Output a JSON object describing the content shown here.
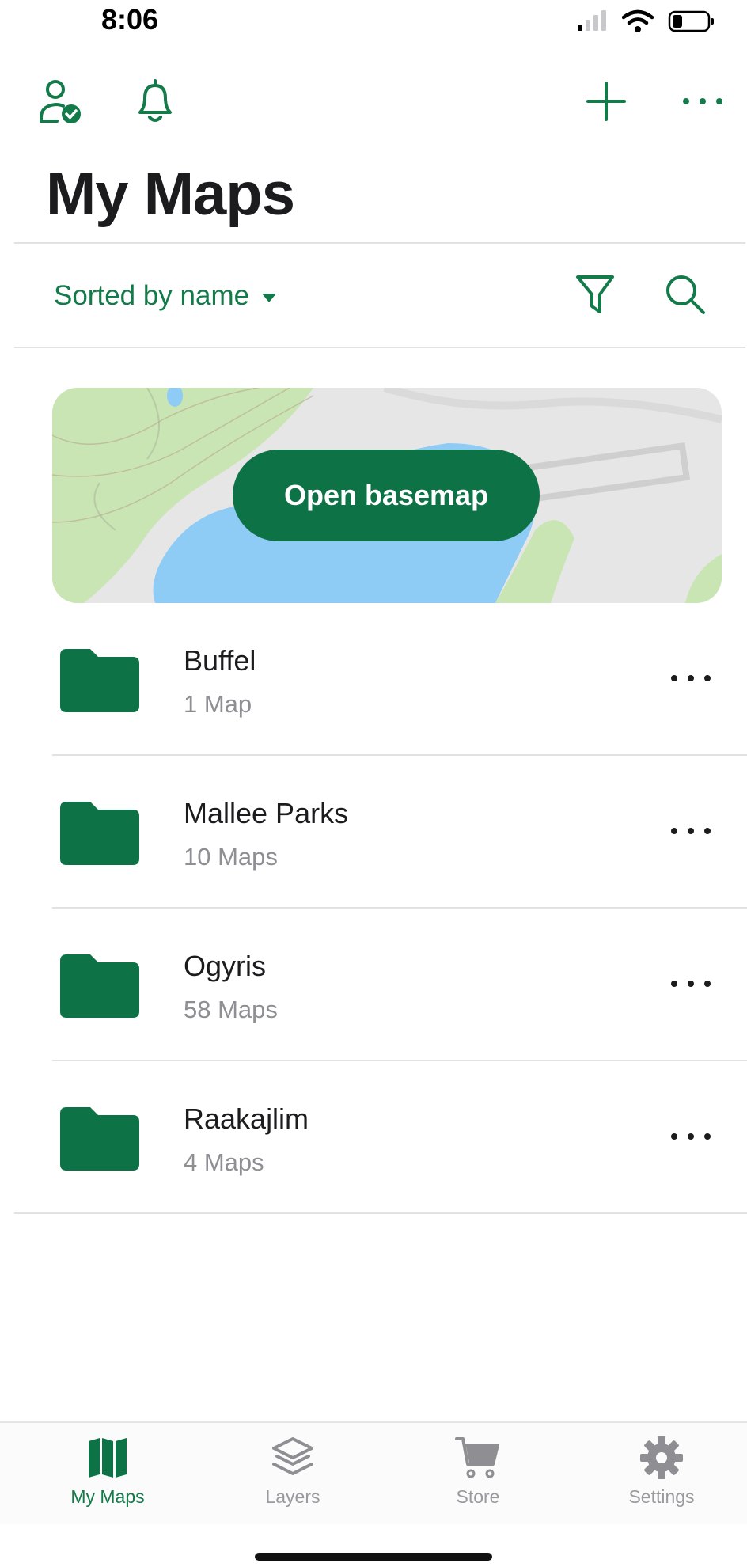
{
  "status_bar": {
    "time": "8:06",
    "icons": [
      "signal-icon",
      "wifi-icon",
      "battery-icon"
    ]
  },
  "header": {
    "account_icon": "account-verified-icon",
    "notifications_icon": "bell-icon",
    "add_icon": "plus-icon",
    "more_icon": "more-horizontal-icon",
    "title": "My Maps"
  },
  "toolbar": {
    "sort_label": "Sorted by name",
    "filter_icon": "filter-icon",
    "search_icon": "search-icon"
  },
  "basemap": {
    "button_label": "Open basemap"
  },
  "folders": [
    {
      "name": "Buffel",
      "count": "1 Map"
    },
    {
      "name": "Mallee Parks",
      "count": "10 Maps"
    },
    {
      "name": "Ogyris",
      "count": "58 Maps"
    },
    {
      "name": "Raakajlim",
      "count": "4 Maps"
    }
  ],
  "tabs": [
    {
      "label": "My Maps",
      "icon": "map-icon",
      "active": true
    },
    {
      "label": "Layers",
      "icon": "layers-icon",
      "active": false
    },
    {
      "label": "Store",
      "icon": "cart-icon",
      "active": false
    },
    {
      "label": "Settings",
      "icon": "gear-icon",
      "active": false
    }
  ],
  "colors": {
    "accent": "#137a4a",
    "button": "#0e7247",
    "muted_text": "#8e8e93",
    "water": "#8ecbf5",
    "land_green": "#bfe3a6"
  }
}
